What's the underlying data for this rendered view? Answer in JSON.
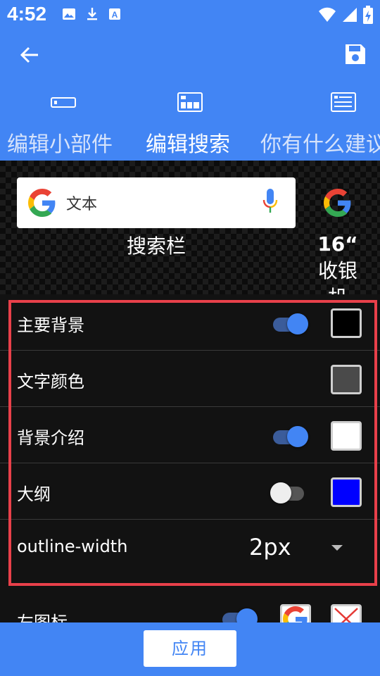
{
  "status_bar": {
    "time": "4:52",
    "icons": [
      "image-icon",
      "download-icon",
      "text-a-icon"
    ],
    "right_icons": [
      "wifi-icon",
      "signal-icon",
      "battery-charging-icon"
    ]
  },
  "app_bar": {
    "back_icon": "arrow-back-icon",
    "save_icon": "save-icon",
    "tabs": [
      {
        "label": "编辑小部件",
        "icon": "widget-icon"
      },
      {
        "label": "编辑搜索",
        "icon": "search-grid-icon"
      },
      {
        "label": "你有什么建议",
        "icon": "suggestion-icon"
      }
    ],
    "active_tab": 1,
    "accent_color": "#4285F4"
  },
  "preview": {
    "search_text": "文本",
    "search_caption": "搜索栏",
    "icon_caption_line1": "16“",
    "icon_caption_line2": "收银机"
  },
  "settings": {
    "rows": [
      {
        "label": "主要背景",
        "toggle": true,
        "color": "#000000"
      },
      {
        "label": "文字颜色",
        "color": "#4a4a4a"
      },
      {
        "label": "背景介绍",
        "toggle": true,
        "color": "#ffffff"
      },
      {
        "label": "大纲",
        "toggle": false,
        "color": "#0000ff"
      }
    ],
    "outline_width": {
      "label": "outline-width",
      "value": "2px"
    },
    "partial_row": {
      "label": "左图标",
      "toggle": true
    }
  },
  "bottom_bar": {
    "apply_label": "应用"
  }
}
